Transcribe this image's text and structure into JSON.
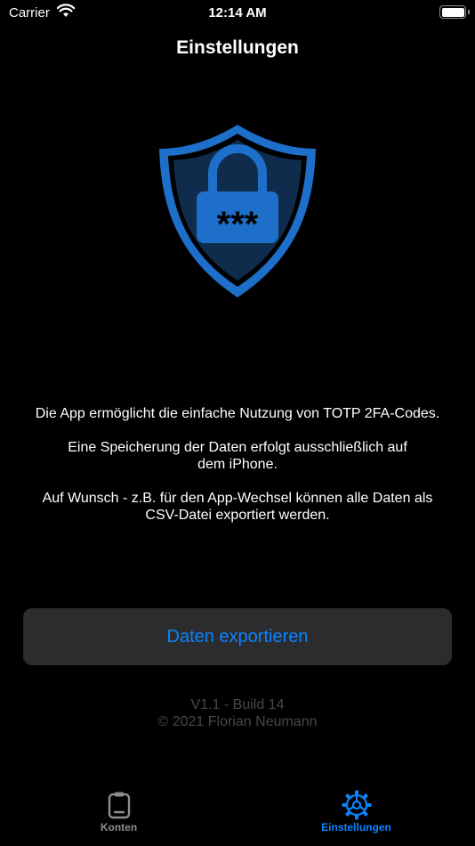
{
  "status_bar": {
    "carrier": "Carrier",
    "time": "12:14 AM",
    "battery_level": 1.0
  },
  "nav": {
    "title": "Einstellungen"
  },
  "shield": {
    "password_text": "***",
    "color": "#1d6fc9"
  },
  "description": [
    "Die App ermöglicht die einfache Nutzung von TOTP 2FA-Codes.",
    "Eine Speicherung der Daten erfolgt ausschließlich auf\ndem iPhone.",
    "Auf Wunsch - z.B. für den App-Wechsel können alle Daten als\nCSV-Datei exportiert werden."
  ],
  "export_button": {
    "label": "Daten exportieren",
    "color": "#0a84ff"
  },
  "version": {
    "build": "V1.1 - Build 14",
    "copyright": "© 2021 Florian Neumann"
  },
  "tabs": [
    {
      "label": "Konten",
      "icon": "clipboard-icon",
      "selected": false
    },
    {
      "label": "Einstellungen",
      "icon": "gear-icon",
      "selected": true
    }
  ]
}
